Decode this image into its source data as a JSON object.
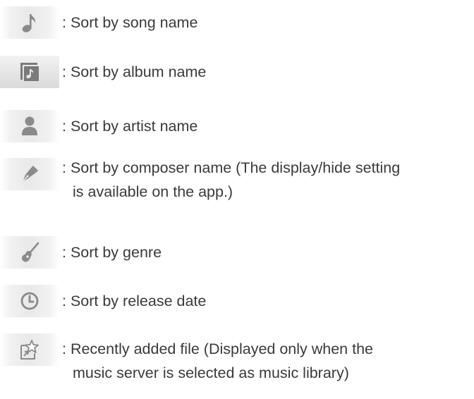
{
  "items": [
    {
      "icon": "music-note-icon",
      "line1": ": Sort by song name",
      "line2": ""
    },
    {
      "icon": "album-icon",
      "line1": ": Sort by album name",
      "line2": ""
    },
    {
      "icon": "artist-person-icon",
      "line1": ": Sort by artist name",
      "line2": ""
    },
    {
      "icon": "pen-nib-icon",
      "line1": ": Sort by composer name (The display/hide setting",
      "line2": "is available on the app.)"
    },
    {
      "icon": "guitar-icon",
      "line1": ": Sort by genre",
      "line2": ""
    },
    {
      "icon": "clock-icon",
      "line1": ": Sort by release date",
      "line2": ""
    },
    {
      "icon": "recently-added-star-icon",
      "line1": ": Recently added file (Displayed only when the",
      "line2": "music server is selected as music library)"
    }
  ],
  "colors": {
    "icon": "#8a8a8a",
    "text": "#3a3a3a",
    "tile": "#e9e9e9"
  }
}
